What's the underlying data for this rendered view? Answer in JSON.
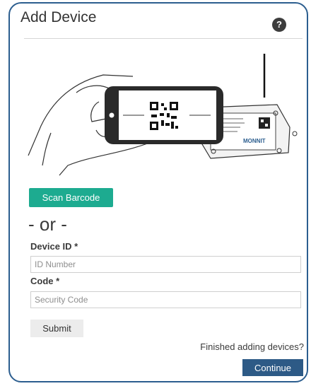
{
  "header": {
    "title": "Add Device",
    "help_icon": "question-mark-icon",
    "help_glyph": "?"
  },
  "illustration": {
    "brand_label": "MONNIT",
    "description_icon": "phone-scanning-sensor-barcode-illustration"
  },
  "actions": {
    "scan_label": "Scan Barcode",
    "or_text": "- or -"
  },
  "form": {
    "device_id_label": "Device ID *",
    "device_id_placeholder": "ID Number",
    "device_id_value": "",
    "code_label": "Code *",
    "code_placeholder": "Security Code",
    "code_value": "",
    "submit_label": "Submit"
  },
  "footer": {
    "finished_text": "Finished adding devices?",
    "continue_label": "Continue"
  },
  "colors": {
    "border": "#2c5e8f",
    "scan_button": "#1dab90",
    "continue_button": "#2d5a86",
    "submit_button": "#ececec"
  }
}
